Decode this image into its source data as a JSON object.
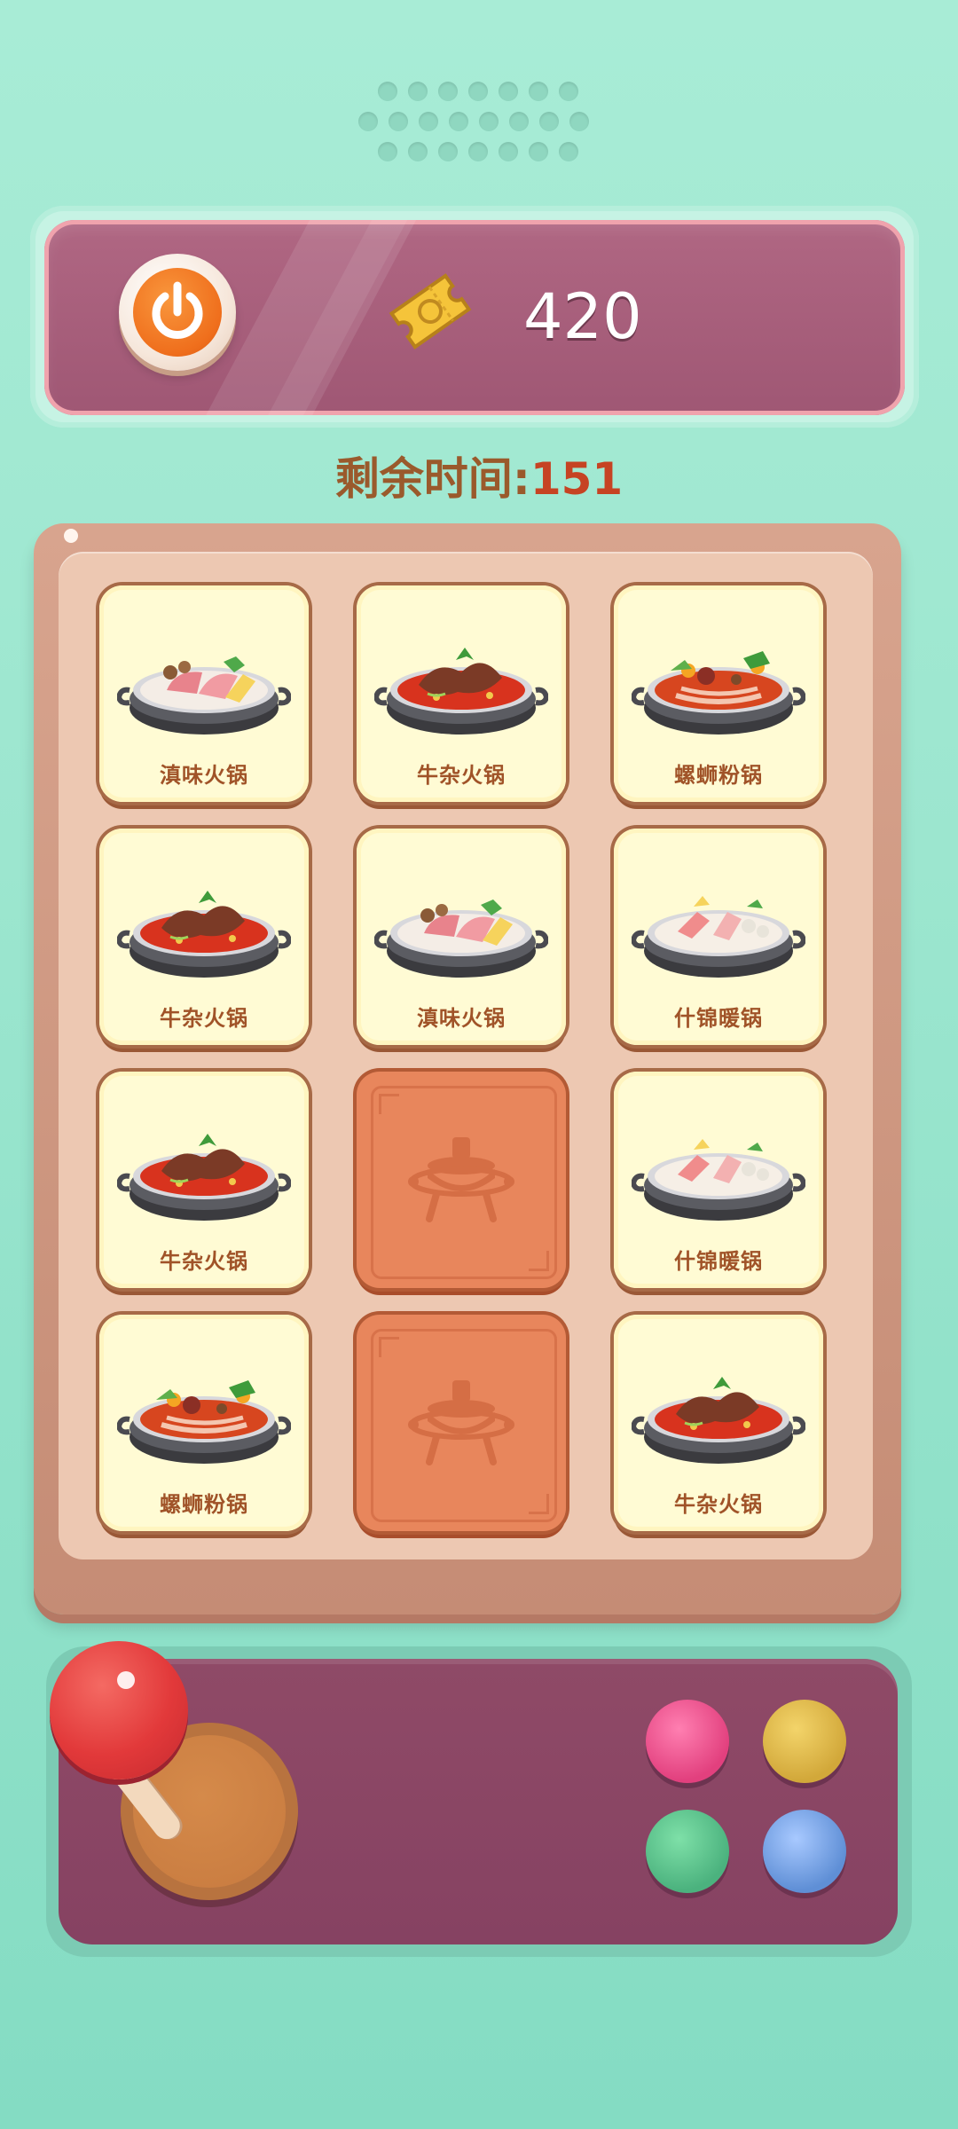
{
  "header": {
    "coins": "420",
    "power_icon": "power-icon",
    "ticket_icon": "ticket-icon"
  },
  "timer": {
    "label": "剩余时间",
    "separator": ":",
    "value": "151"
  },
  "board": {
    "cards": [
      {
        "state": "face",
        "name": "滇味火锅",
        "dish": "dianwei"
      },
      {
        "state": "face",
        "name": "牛杂火锅",
        "dish": "niuza"
      },
      {
        "state": "face",
        "name": "螺蛳粉锅",
        "dish": "luosifen"
      },
      {
        "state": "face",
        "name": "牛杂火锅",
        "dish": "niuza"
      },
      {
        "state": "face",
        "name": "滇味火锅",
        "dish": "dianwei"
      },
      {
        "state": "face",
        "name": "什锦暖锅",
        "dish": "shijin"
      },
      {
        "state": "face",
        "name": "牛杂火锅",
        "dish": "niuza"
      },
      {
        "state": "back",
        "name": "",
        "dish": ""
      },
      {
        "state": "face",
        "name": "什锦暖锅",
        "dish": "shijin"
      },
      {
        "state": "face",
        "name": "螺蛳粉锅",
        "dish": "luosifen"
      },
      {
        "state": "back",
        "name": "",
        "dish": ""
      },
      {
        "state": "face",
        "name": "牛杂火锅",
        "dish": "niuza"
      }
    ]
  },
  "controller": {
    "buttons": [
      "pink",
      "yellow",
      "green",
      "blue"
    ],
    "colors": {
      "pink": "#e2407e",
      "yellow": "#d2a83a",
      "green": "#4bb27e",
      "blue": "#5f8fd6",
      "joystick": "#e2393a"
    }
  },
  "colors": {
    "background": "#a8ecd6",
    "banner": "#a95f7c",
    "board": "#d8a48e",
    "card_face": "#fffbd4",
    "card_back": "#e8865c",
    "timer_text": "#9a5a2c",
    "timer_value": "#c64323"
  }
}
